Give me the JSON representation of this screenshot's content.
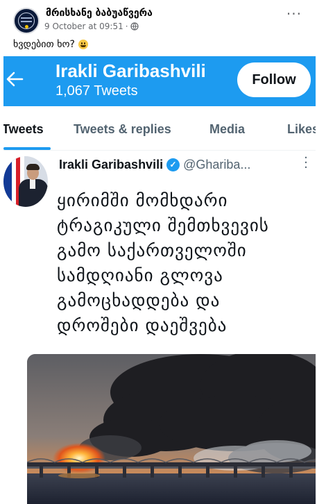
{
  "post": {
    "author": "მრისხანე ბაბუაწვერა",
    "timestamp": "9 October at 09:51",
    "audience_icon": "globe-icon",
    "more_icon": "more-dots-icon",
    "caption": "ხვდებით ხო?",
    "caption_emoji": "smiling-face-emoji"
  },
  "twitter": {
    "header": {
      "back_icon": "back-arrow-icon",
      "name": "Irakli Garibashvili",
      "tweet_count": "1,067 Tweets",
      "follow_label": "Follow"
    },
    "tabs": [
      {
        "label": "Tweets",
        "active": true
      },
      {
        "label": "Tweets & replies",
        "active": false
      },
      {
        "label": "Media",
        "active": false
      },
      {
        "label": "Likes",
        "active": false
      }
    ],
    "tweet": {
      "author": "Irakli Garibashvili",
      "verified_icon": "verified-badge-icon",
      "handle": "@Ghariba...",
      "text_lines": [
        "ყირიმში მომხდარი",
        "ტრაგიკული შემთხვევის",
        "გამო საქართველოში",
        "სამდღიანი გლოვა",
        "გამოცხადდება და",
        "დროშები დაეშვება"
      ]
    }
  },
  "colors": {
    "twitter_blue": "#1d9bf0",
    "fb_secondary_text": "#65676b",
    "tw_secondary_text": "#536471"
  }
}
